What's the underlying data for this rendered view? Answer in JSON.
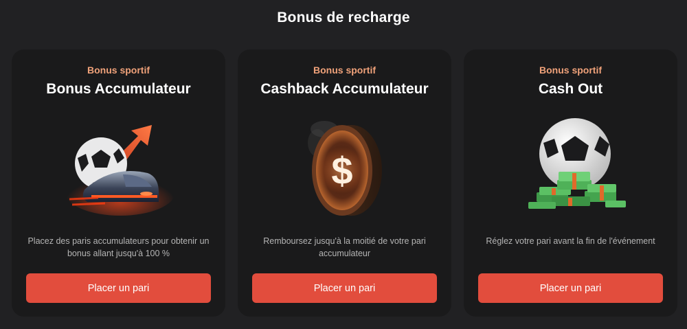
{
  "section_title": "Bonus de recharge",
  "cards": [
    {
      "tag": "Bonus sportif",
      "title": "Bonus Accumulateur",
      "icon": "ball-train-arrow-icon",
      "description": "Placez des paris accumulateurs pour obtenir un bonus allant jusqu'à 100 %",
      "button": "Placer un pari"
    },
    {
      "tag": "Bonus sportif",
      "title": "Cashback Accumulateur",
      "icon": "dollar-coin-icon",
      "description": "Remboursez jusqu'à la moitié de votre pari accumulateur",
      "button": "Placer un pari"
    },
    {
      "tag": "Bonus sportif",
      "title": "Cash Out",
      "icon": "ball-money-icon",
      "description": "Réglez votre pari avant la fin de l'événement",
      "button": "Placer un pari"
    }
  ],
  "colors": {
    "background": "#212123",
    "card": "#1a1a1b",
    "accent": "#e24d3d",
    "tag": "#f0a27a"
  }
}
